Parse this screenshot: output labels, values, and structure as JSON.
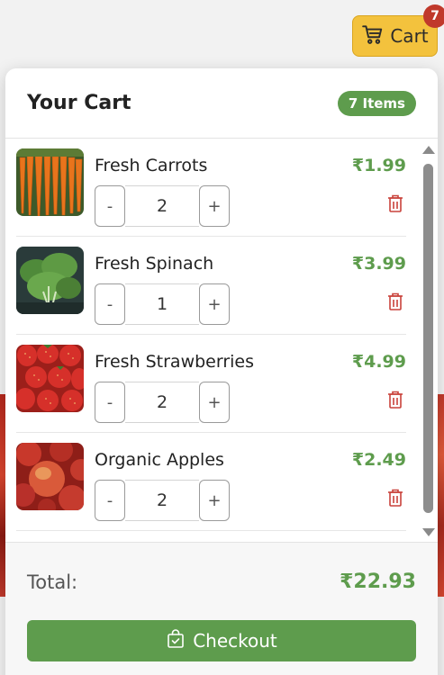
{
  "cart_button": {
    "label": "Cart",
    "count": "7",
    "icon": "cart-icon",
    "color": "#f3c23d"
  },
  "cart": {
    "title": "Your Cart",
    "items_badge": "7 Items",
    "accent_color": "#5e9c4d",
    "items": [
      {
        "name": "Fresh Carrots",
        "price": "₹1.99",
        "quantity": "2",
        "image": "carrots-image"
      },
      {
        "name": "Fresh Spinach",
        "price": "₹3.99",
        "quantity": "1",
        "image": "spinach-image"
      },
      {
        "name": "Fresh Strawberries",
        "price": "₹4.99",
        "quantity": "2",
        "image": "strawberries-image"
      },
      {
        "name": "Organic Apples",
        "price": "₹2.49",
        "quantity": "2",
        "image": "apples-image"
      }
    ],
    "decrement_label": "-",
    "increment_label": "+",
    "total_label": "Total:",
    "total_value": "₹22.93",
    "checkout_label": "Checkout"
  }
}
